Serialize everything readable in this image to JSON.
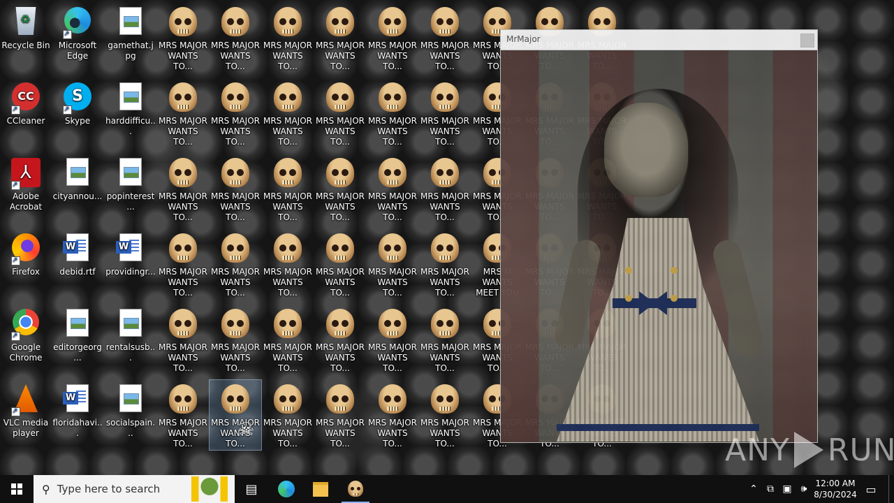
{
  "desktop": {
    "icons": [
      {
        "label": "Recycle Bin",
        "type": "recycle",
        "shortcut": false
      },
      {
        "label": "Microsoft Edge",
        "type": "edge",
        "shortcut": true
      },
      {
        "label": "gamethat.jpg",
        "type": "image",
        "shortcut": false
      },
      {
        "label": "CCleaner",
        "type": "ccleaner",
        "shortcut": true
      },
      {
        "label": "Skype",
        "type": "skype",
        "shortcut": true
      },
      {
        "label": "harddifficu...",
        "type": "image",
        "shortcut": false
      },
      {
        "label": "Adobe Acrobat",
        "type": "acrobat",
        "shortcut": true
      },
      {
        "label": "cityannou...",
        "type": "image",
        "shortcut": false
      },
      {
        "label": "popinterest...",
        "type": "image",
        "shortcut": false
      },
      {
        "label": "Firefox",
        "type": "firefox",
        "shortcut": true
      },
      {
        "label": "debid.rtf",
        "type": "word",
        "shortcut": false
      },
      {
        "label": "providingr...",
        "type": "word",
        "shortcut": false
      },
      {
        "label": "Google Chrome",
        "type": "chrome",
        "shortcut": true
      },
      {
        "label": "editorgeorg...",
        "type": "image",
        "shortcut": false
      },
      {
        "label": "rentalsusb...",
        "type": "image",
        "shortcut": false
      },
      {
        "label": "VLC media player",
        "type": "vlc",
        "shortcut": true
      },
      {
        "label": "floridahavi...",
        "type": "word",
        "shortcut": false
      },
      {
        "label": "socialspain...",
        "type": "image",
        "shortcut": false
      }
    ],
    "skull_label": "MRS MAJOR WANTS TO...",
    "skull_label_clipped": "MRS M WANTS",
    "skull_label_meet": "MRS M WANTS MEET YOU",
    "selected_label": "MRS MAJOR WANTS TO..."
  },
  "window": {
    "title": "MrMajor"
  },
  "watermark": {
    "left": "ANY",
    "right": "RUN"
  },
  "taskbar": {
    "search_placeholder": "Type here to search",
    "time": "12:00 AM",
    "date": "8/30/2024",
    "icons": [
      "windows-start-icon",
      "search-icon",
      "task-view-icon",
      "edge-icon",
      "file-explorer-icon",
      "skull-app-icon"
    ]
  }
}
